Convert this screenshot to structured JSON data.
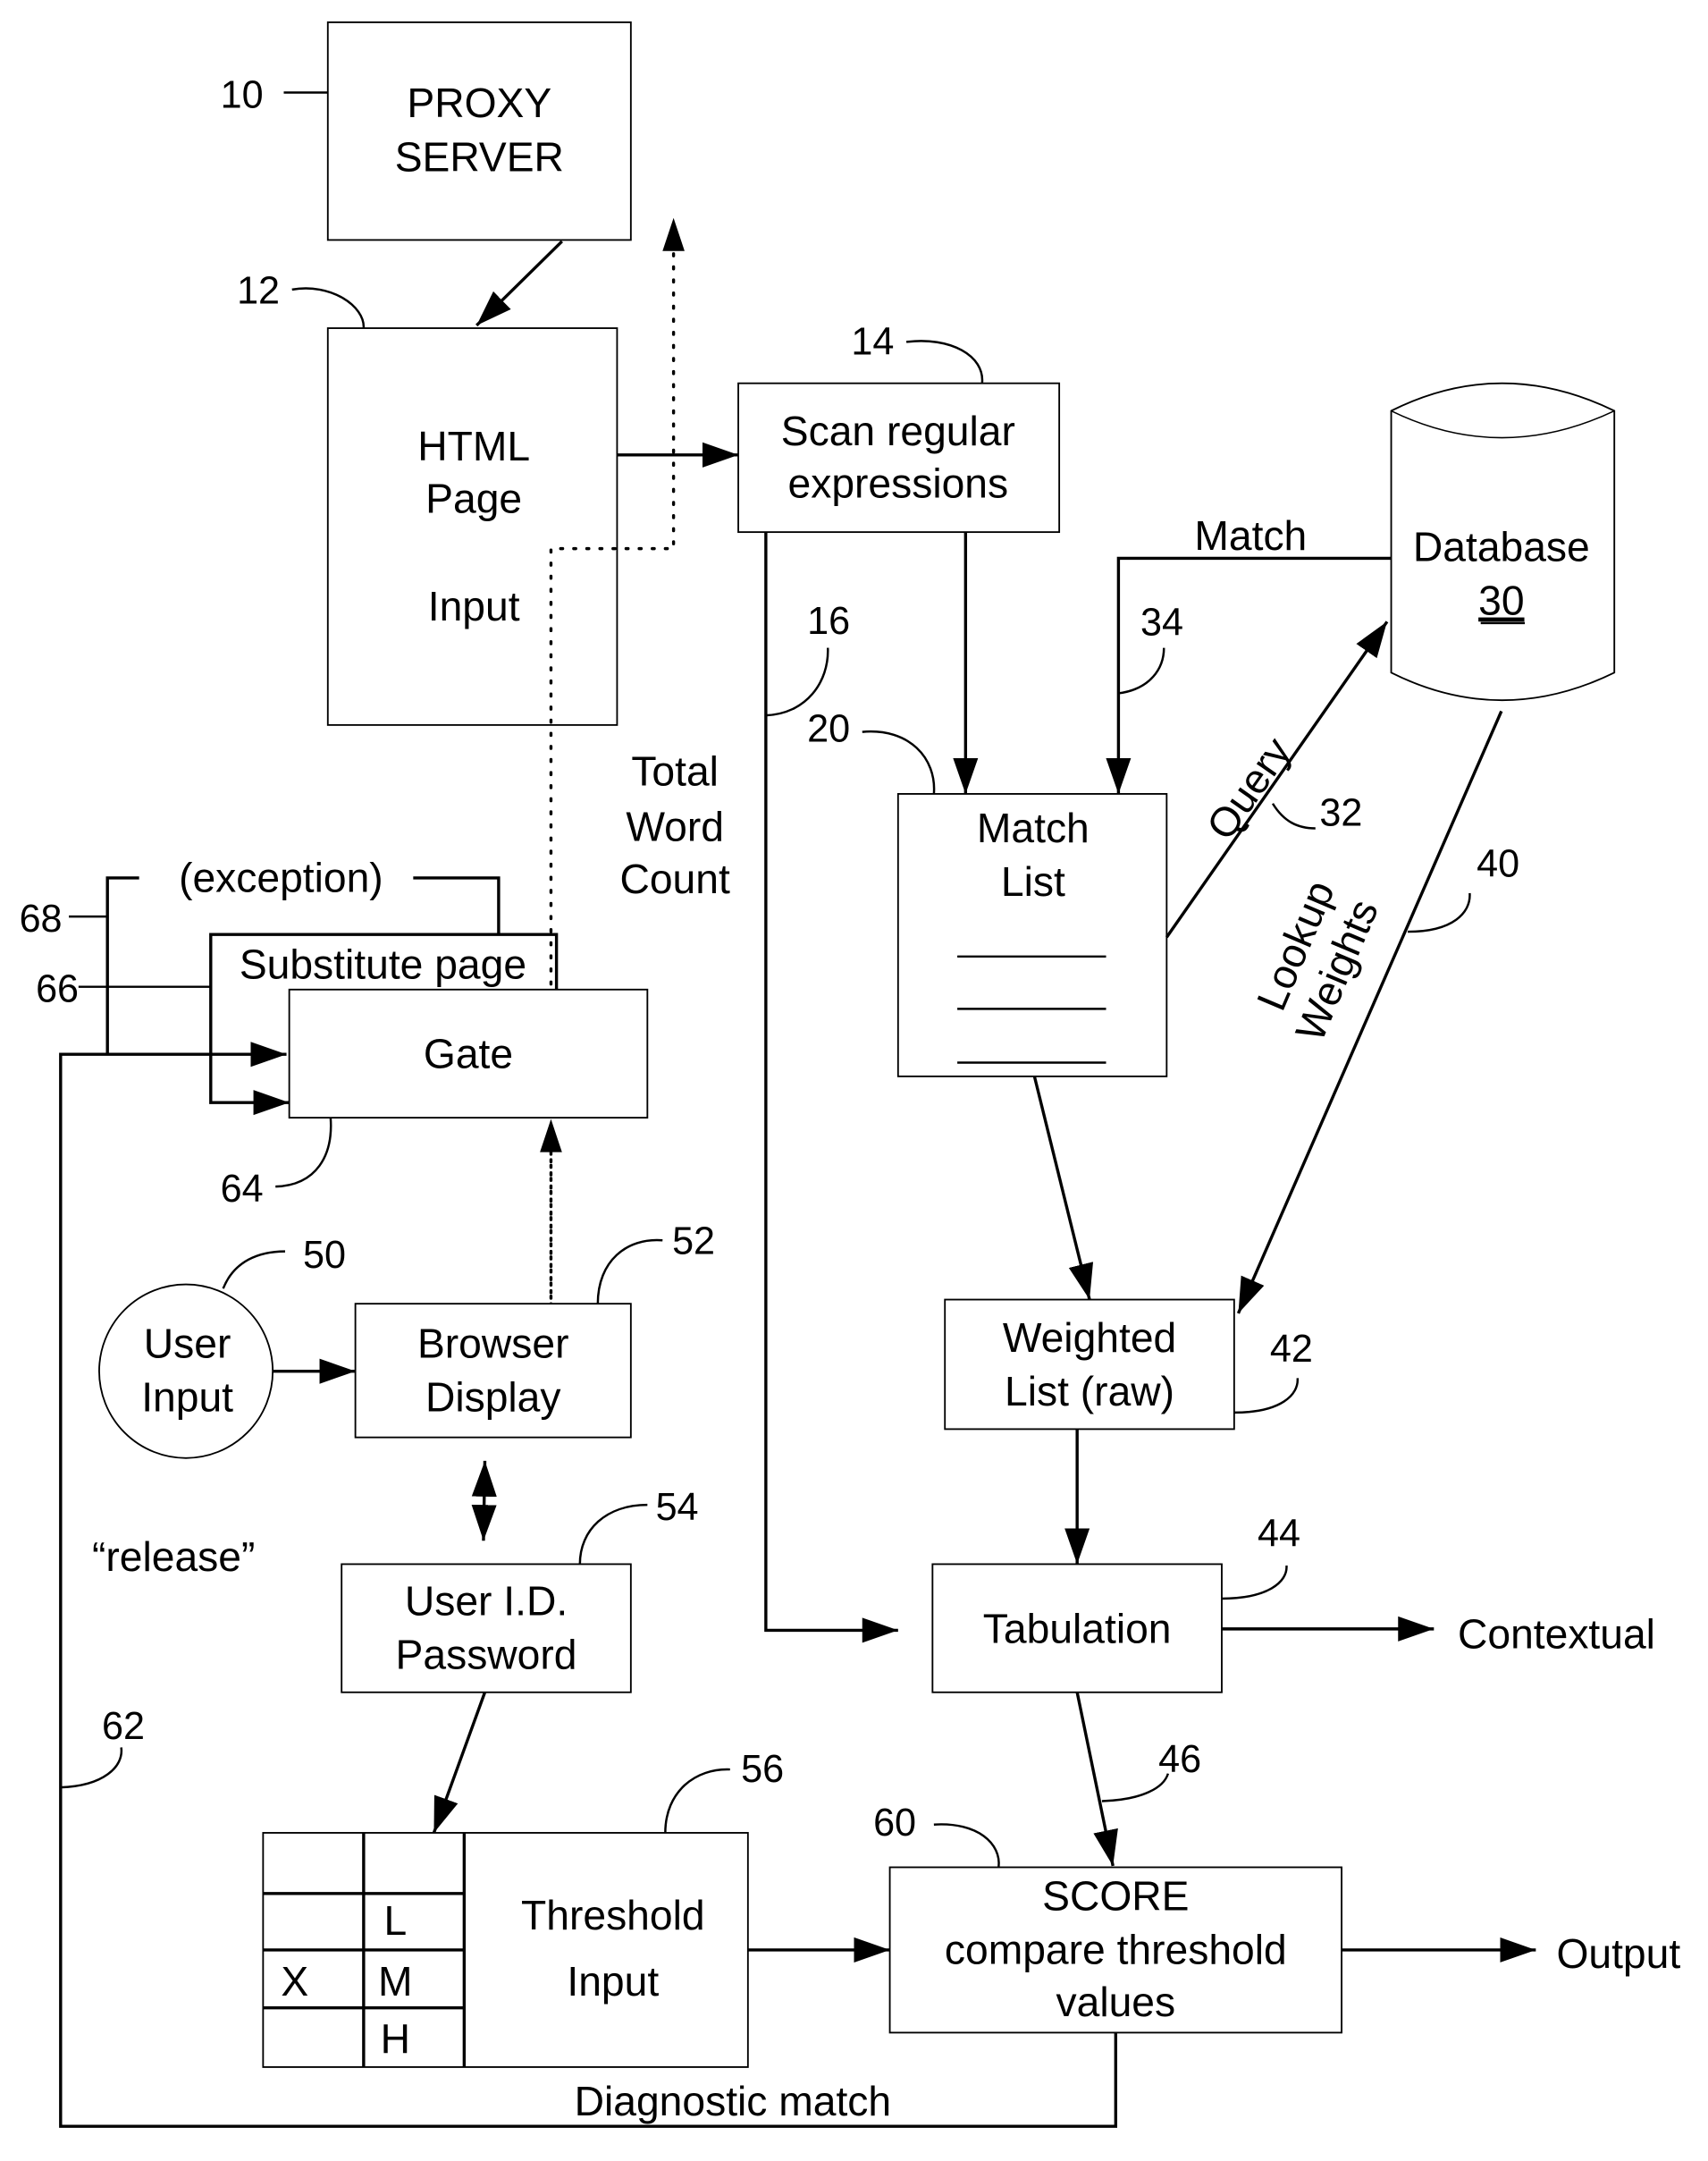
{
  "figure": {
    "nodes": {
      "proxy_server": {
        "ref": "10",
        "line1": "PROXY",
        "line2": "SERVER"
      },
      "html_page": {
        "ref": "12",
        "line1": "HTML",
        "line2": "Page",
        "line3": "Input"
      },
      "scan": {
        "ref": "14",
        "line1": "Scan regular",
        "line2": "expressions"
      },
      "database": {
        "line1": "Database",
        "ref": "30"
      },
      "match_list": {
        "ref": "20",
        "line1": "Match",
        "line2": "List"
      },
      "weighted_list": {
        "ref": "42",
        "line1": "Weighted",
        "line2": "List (raw)"
      },
      "tabulation": {
        "ref": "44",
        "label": "Tabulation"
      },
      "score": {
        "ref": "60",
        "line1": "SCORE",
        "line2": "compare threshold",
        "line3": "values"
      },
      "gate": {
        "ref": "64",
        "label": "Gate"
      },
      "user_input": {
        "ref": "50",
        "line1": "User",
        "line2": "Input"
      },
      "browser_display": {
        "ref": "52",
        "line1": "Browser",
        "line2": "Display"
      },
      "user_id": {
        "ref": "54",
        "line1": "User I.D.",
        "line2": "Password"
      },
      "threshold_input": {
        "ref": "56",
        "line1": "Threshold",
        "line2": "Input",
        "grid": {
          "col1": [
            "",
            "",
            "X",
            ""
          ],
          "col2": [
            "",
            "L",
            "M",
            "H"
          ]
        }
      }
    },
    "edge_labels": {
      "match": "Match",
      "match_ref": "34",
      "query": "Query",
      "query_ref": "32",
      "lookup": "Lookup",
      "weights": "Weights",
      "lookup_ref": "40",
      "word_count_line1": "Total",
      "word_count_line2": "Word",
      "word_count_line3": "Count",
      "scan_to_tab_ref": "16",
      "tab_to_score_ref": "46",
      "contextual": "Contextual",
      "output": "Output",
      "exception": "(exception)",
      "exception_ref": "68",
      "substitute_page": "Substitute page",
      "substitute_ref": "66",
      "release": "“release”",
      "release_ref": "62",
      "diagnostic_match": "Diagnostic match"
    }
  }
}
